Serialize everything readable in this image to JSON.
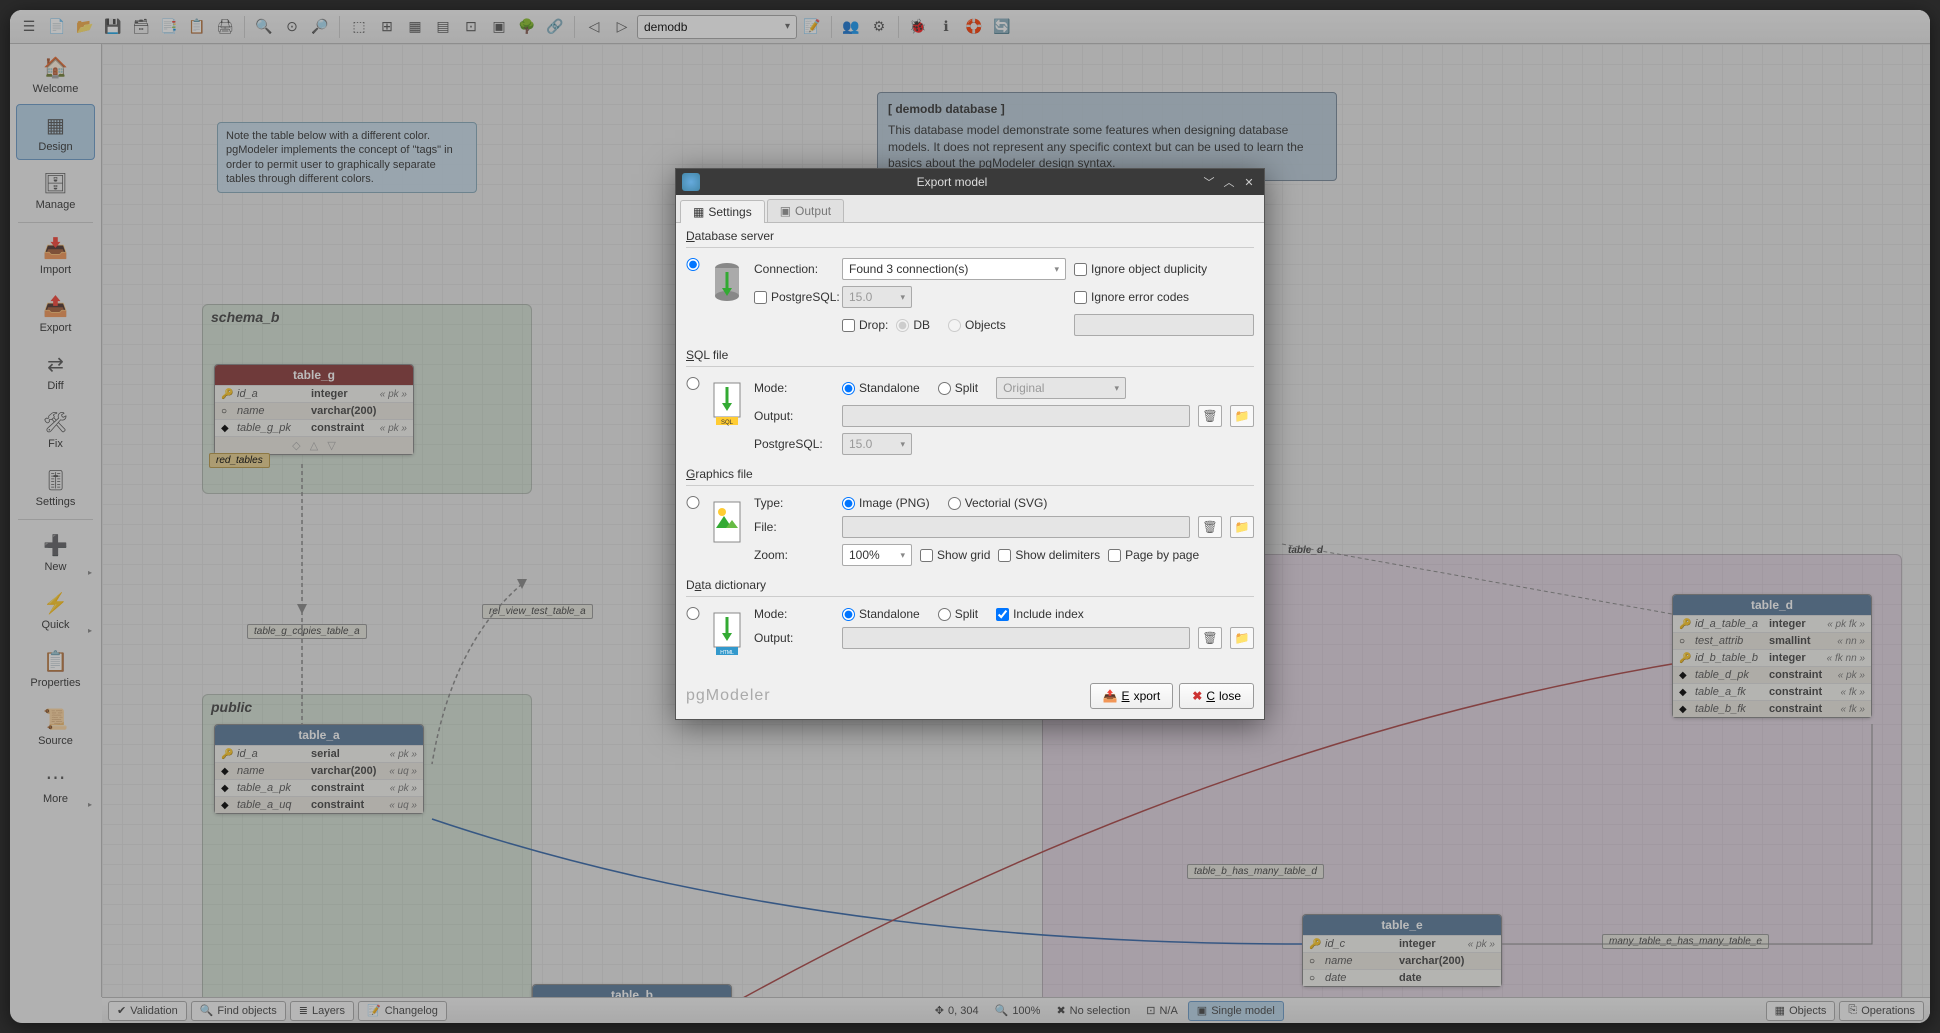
{
  "toolbar": {
    "db_combo": "demodb"
  },
  "sidebar": {
    "welcome": "Welcome",
    "design": "Design",
    "manage": "Manage",
    "import": "Import",
    "export": "Export",
    "diff": "Diff",
    "fix": "Fix",
    "settings": "Settings",
    "new": "New",
    "quick": "Quick",
    "properties": "Properties",
    "source": "Source",
    "more": "More"
  },
  "canvas": {
    "note1": "Note the table below with a different color. pgModeler implements the concept of \"tags\" in order to permit user to graphically separate tables through different colors.",
    "schema_b": "schema_b",
    "public": "public",
    "dbnote_hdr": "[ demodb database ]",
    "dbnote_body": "This database model demonstrate some features when designing database models. It does not represent any specific context but can be used to learn the basics about the pgModeler design syntax.",
    "red_tables": "red_tables",
    "rel_g_copies_a": "table_g_copies_table_a",
    "rel_view_test_a": "rel_view_test_table_a",
    "rel_b_has_d": "table_b_has_many_table_d",
    "rel_e_has_e": "many_table_e_has_many_table_e",
    "schema_d_label": "table_d"
  },
  "tables": {
    "g": {
      "name": "table_g",
      "rows": [
        {
          "icon": "🔑",
          "name": "id_a",
          "type": "integer",
          "tag": "« pk »"
        },
        {
          "icon": "○",
          "name": "name",
          "type": "varchar(200)",
          "tag": ""
        },
        {
          "icon": "◆",
          "name": "table_g_pk",
          "type": "constraint",
          "tag": "« pk »"
        }
      ]
    },
    "a": {
      "name": "table_a",
      "rows": [
        {
          "icon": "🔑",
          "name": "id_a",
          "type": "serial",
          "tag": "« pk »"
        },
        {
          "icon": "◆",
          "name": "name",
          "type": "varchar(200)",
          "tag": "« uq »"
        },
        {
          "icon": "◆",
          "name": "table_a_pk",
          "type": "constraint",
          "tag": "« pk »"
        },
        {
          "icon": "◆",
          "name": "table_a_uq",
          "type": "constraint",
          "tag": "« uq »"
        }
      ]
    },
    "b": {
      "name": "table_b"
    },
    "d": {
      "name": "table_d",
      "rows": [
        {
          "icon": "🔑",
          "name": "id_a_table_a",
          "type": "integer",
          "tag": "« pk fk »"
        },
        {
          "icon": "○",
          "name": "test_attrib",
          "type": "smallint",
          "tag": "« nn »"
        },
        {
          "icon": "🔑",
          "name": "id_b_table_b",
          "type": "integer",
          "tag": "« fk nn »"
        },
        {
          "icon": "◆",
          "name": "table_d_pk",
          "type": "constraint",
          "tag": "« pk »"
        },
        {
          "icon": "◆",
          "name": "table_a_fk",
          "type": "constraint",
          "tag": "« fk »"
        },
        {
          "icon": "◆",
          "name": "table_b_fk",
          "type": "constraint",
          "tag": "« fk »"
        }
      ]
    },
    "e": {
      "name": "table_e",
      "rows": [
        {
          "icon": "🔑",
          "name": "id_c",
          "type": "integer",
          "tag": "« pk »"
        },
        {
          "icon": "○",
          "name": "name",
          "type": "varchar(200)",
          "tag": ""
        },
        {
          "icon": "○",
          "name": "date",
          "type": "date",
          "tag": ""
        }
      ]
    }
  },
  "dialog": {
    "title": "Export model",
    "tab_settings": "Settings",
    "tab_output": "Output",
    "db_server": "Database server",
    "connection": "Connection:",
    "connection_val": "Found 3 connection(s)",
    "postgresql": "PostgreSQL:",
    "pg_ver": "15.0",
    "drop": "Drop:",
    "drop_db": "DB",
    "drop_objects": "Objects",
    "ignore_dup": "Ignore object duplicity",
    "ignore_err": "Ignore error codes",
    "sql_file": "SQL file",
    "mode": "Mode:",
    "standalone": "Standalone",
    "split": "Split",
    "original": "Original",
    "output": "Output:",
    "graphics_file": "Graphics file",
    "type": "Type:",
    "image_png": "Image (PNG)",
    "vectorial_svg": "Vectorial (SVG)",
    "file": "File:",
    "zoom": "Zoom:",
    "zoom_val": "100%",
    "show_grid": "Show grid",
    "show_delim": "Show delimiters",
    "page_by_page": "Page by page",
    "data_dict": "Data dictionary",
    "include_index": "Include index",
    "brand": "pgModeler",
    "btn_export": "Export",
    "btn_close": "Close"
  },
  "status": {
    "validation": "Validation",
    "find": "Find objects",
    "layers": "Layers",
    "changelog": "Changelog",
    "coords": "0, 304",
    "zoom": "100%",
    "selection": "No selection",
    "na": "N/A",
    "single": "Single model",
    "objects": "Objects",
    "operations": "Operations"
  }
}
